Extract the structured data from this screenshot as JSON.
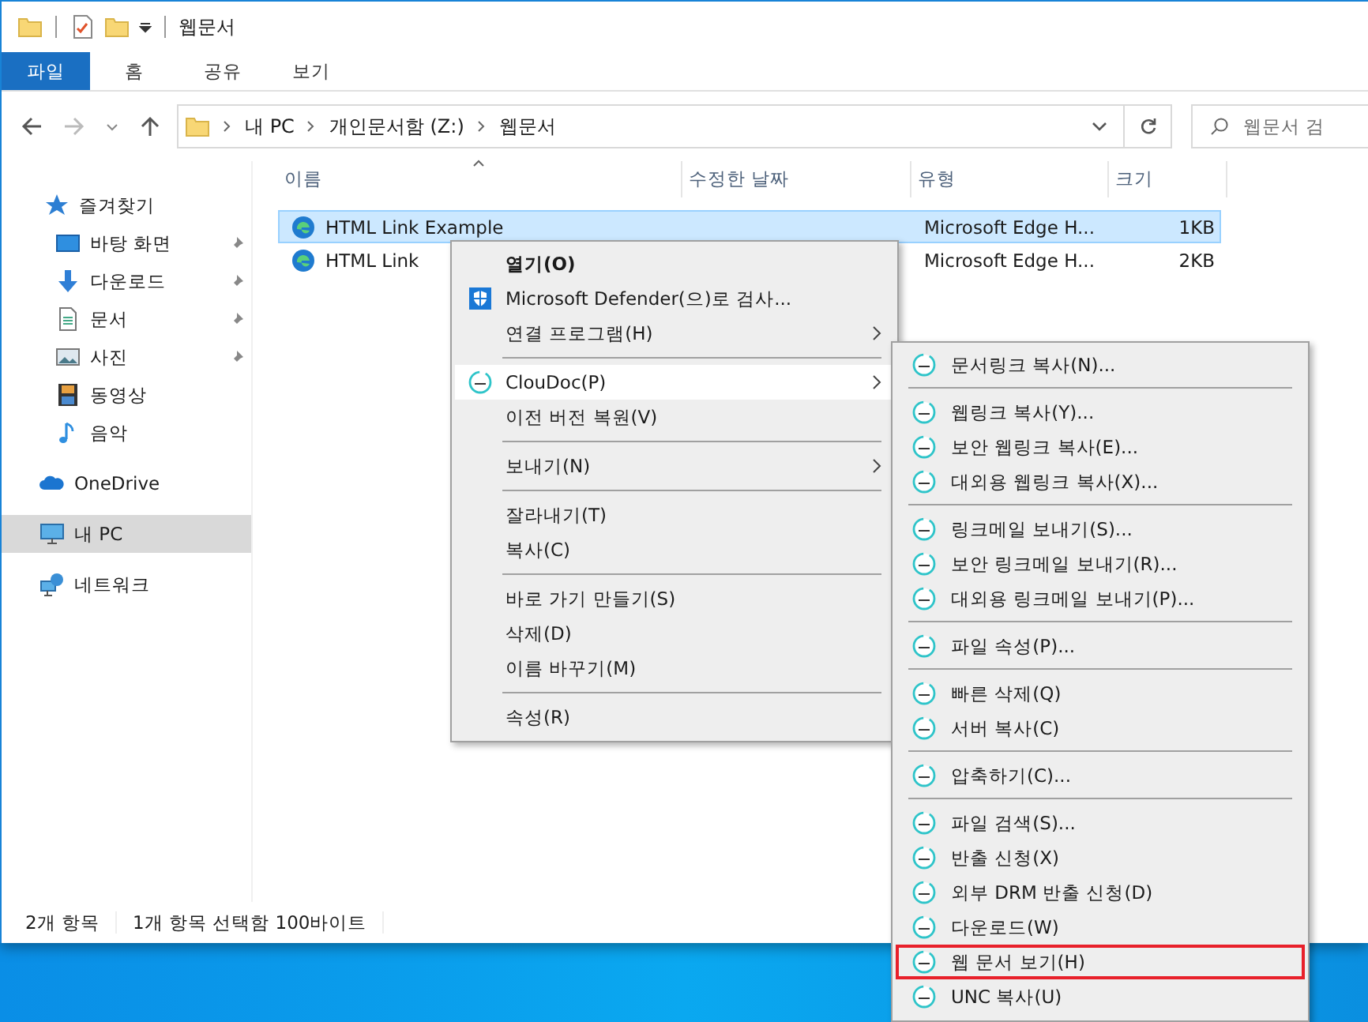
{
  "window": {
    "title": "웹문서"
  },
  "ribbon_tabs": [
    {
      "label": "파일",
      "selected": true
    },
    {
      "label": "홈",
      "selected": false
    },
    {
      "label": "공유",
      "selected": false
    },
    {
      "label": "보기",
      "selected": false
    }
  ],
  "address_bar": {
    "path": [
      "내 PC",
      "개인문서함 (Z:)",
      "웹문서"
    ],
    "search_placeholder": "웹문서 검"
  },
  "sidebar": [
    {
      "label": "즐겨찾기",
      "kind": "star",
      "selected": false,
      "children": [
        {
          "label": "바탕 화면",
          "kind": "desktop",
          "pinned": true,
          "selected": false
        },
        {
          "label": "다운로드",
          "kind": "download",
          "pinned": true,
          "selected": false
        },
        {
          "label": "문서",
          "kind": "document",
          "pinned": true,
          "selected": false
        },
        {
          "label": "사진",
          "kind": "pictures",
          "pinned": true,
          "selected": false
        },
        {
          "label": "동영상",
          "kind": "video",
          "pinned": false,
          "selected": false
        },
        {
          "label": "음악",
          "kind": "music",
          "pinned": false,
          "selected": false
        }
      ]
    },
    {
      "label": "OneDrive",
      "kind": "cloud",
      "selected": false
    },
    {
      "label": "내 PC",
      "kind": "pc",
      "selected": true
    },
    {
      "label": "네트워크",
      "kind": "network",
      "selected": false
    }
  ],
  "files": {
    "columns": [
      "이름",
      "수정한 날짜",
      "유형",
      "크기"
    ],
    "rows": [
      {
        "name": "HTML Link Example",
        "type": "Microsoft Edge H...",
        "size": "1KB",
        "selected": true
      },
      {
        "name": "HTML Link",
        "type": "Microsoft Edge H...",
        "size": "2KB",
        "selected": false
      }
    ]
  },
  "status_bar": [
    "2개 항목",
    "1개 항목 선택함 100바이트"
  ],
  "context_menu": {
    "groups": [
      {
        "items": [
          {
            "label": "열기(O)",
            "kind": "plain",
            "default": true,
            "has_submenu": false,
            "selected": false
          },
          {
            "label": "Microsoft Defender(으)로 검사...",
            "kind": "defender",
            "default": false,
            "has_submenu": false,
            "selected": false
          },
          {
            "label": "연결 프로그램(H)",
            "kind": "plain",
            "default": false,
            "has_submenu": true,
            "selected": false
          }
        ]
      },
      {
        "items": [
          {
            "label": "ClouDoc(P)",
            "kind": "cloudoc",
            "default": false,
            "has_submenu": true,
            "selected": true
          },
          {
            "label": "이전 버전 복원(V)",
            "kind": "plain",
            "default": false,
            "has_submenu": false,
            "selected": false
          }
        ]
      },
      {
        "items": [
          {
            "label": "보내기(N)",
            "kind": "plain",
            "default": false,
            "has_submenu": true,
            "selected": false
          }
        ]
      },
      {
        "items": [
          {
            "label": "잘라내기(T)",
            "kind": "plain",
            "default": false,
            "has_submenu": false,
            "selected": false
          },
          {
            "label": "복사(C)",
            "kind": "plain",
            "default": false,
            "has_submenu": false,
            "selected": false
          }
        ]
      },
      {
        "items": [
          {
            "label": "바로 가기 만들기(S)",
            "kind": "plain",
            "default": false,
            "has_submenu": false,
            "selected": false
          },
          {
            "label": "삭제(D)",
            "kind": "plain",
            "default": false,
            "has_submenu": false,
            "selected": false
          },
          {
            "label": "이름 바꾸기(M)",
            "kind": "plain",
            "default": false,
            "has_submenu": false,
            "selected": false
          }
        ]
      },
      {
        "items": [
          {
            "label": "속성(R)",
            "kind": "plain",
            "default": false,
            "has_submenu": false,
            "selected": false
          }
        ]
      }
    ]
  },
  "cloudoc_submenu": {
    "groups": [
      {
        "items": [
          {
            "label": "문서링크 복사(N)...",
            "highlighted": false
          }
        ]
      },
      {
        "items": [
          {
            "label": "웹링크 복사(Y)...",
            "highlighted": false
          },
          {
            "label": "보안 웹링크 복사(E)...",
            "highlighted": false
          },
          {
            "label": "대외용 웹링크 복사(X)...",
            "highlighted": false
          }
        ]
      },
      {
        "items": [
          {
            "label": "링크메일 보내기(S)...",
            "highlighted": false
          },
          {
            "label": "보안 링크메일 보내기(R)...",
            "highlighted": false
          },
          {
            "label": "대외용 링크메일 보내기(P)...",
            "highlighted": false
          }
        ]
      },
      {
        "items": [
          {
            "label": "파일 속성(P)...",
            "highlighted": false
          }
        ]
      },
      {
        "items": [
          {
            "label": "빠른 삭제(Q)",
            "highlighted": false
          },
          {
            "label": "서버 복사(C)",
            "highlighted": false
          }
        ]
      },
      {
        "items": [
          {
            "label": "압축하기(C)...",
            "highlighted": false
          }
        ]
      },
      {
        "items": [
          {
            "label": "파일 검색(S)...",
            "highlighted": false
          },
          {
            "label": "반출 신청(X)",
            "highlighted": false
          },
          {
            "label": "외부 DRM 반출 신청(D)",
            "highlighted": false
          },
          {
            "label": "다운로드(W)",
            "highlighted": false
          },
          {
            "label": "웹 문서 보기(H)",
            "highlighted": true
          },
          {
            "label": "UNC 복사(U)",
            "highlighted": false
          }
        ]
      }
    ]
  }
}
